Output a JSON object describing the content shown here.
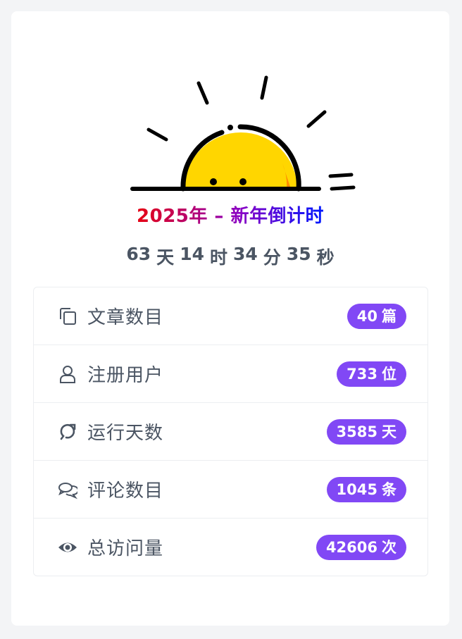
{
  "countdown": {
    "title": "2025年 – 新年倒计时",
    "days": "63",
    "days_unit": "天",
    "hours": "14",
    "hours_unit": "时",
    "minutes": "34",
    "minutes_unit": "分",
    "seconds": "35",
    "seconds_unit": "秒"
  },
  "stats": [
    {
      "label": "文章数目",
      "value": "40",
      "unit": "篇",
      "icon": "copy-icon"
    },
    {
      "label": "注册用户",
      "value": "733",
      "unit": "位",
      "icon": "user-icon"
    },
    {
      "label": "运行天数",
      "value": "3585",
      "unit": "天",
      "icon": "loop-icon"
    },
    {
      "label": "评论数目",
      "value": "1045",
      "unit": "条",
      "icon": "comments-icon"
    },
    {
      "label": "总访问量",
      "value": "42606",
      "unit": "次",
      "icon": "eye-icon"
    }
  ],
  "colors": {
    "badge": "#8148f5",
    "title_gradient_start": "#e60012",
    "title_gradient_end": "#0019ff",
    "sun": "#ffd600",
    "sun_shade": "#ff8a00"
  }
}
